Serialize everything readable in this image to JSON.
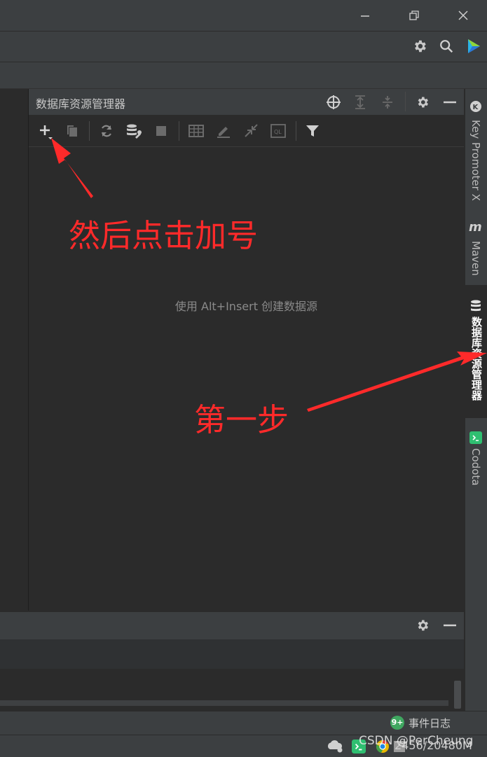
{
  "window": {
    "minimize_icon": "minimize-icon",
    "restore_icon": "restore-icon",
    "close_icon": "close-icon"
  },
  "toolbar": {
    "settings_icon": "gear-icon",
    "search_icon": "search-icon",
    "plugin_icon": "plugin-logo-icon"
  },
  "panel": {
    "title": "数据库资源管理器",
    "empty_text": "使用 Alt+Insert 创建数据源"
  },
  "annotations": {
    "step_add": "然后点击加号",
    "step_one": "第一步"
  },
  "right_tabs": [
    {
      "label": "Key Promoter X"
    },
    {
      "label": "Maven"
    },
    {
      "label": "数据库资源管理器"
    },
    {
      "label": "Codota"
    }
  ],
  "status": {
    "event_badge": "9+",
    "event_log": "事件日志",
    "watermark": "CSDN @PerCheung",
    "memory": "2456/20480M"
  },
  "colors": {
    "annotation_red": "#ff2a2a",
    "event_green": "#3fa760",
    "codota_green": "#2fbf71"
  }
}
